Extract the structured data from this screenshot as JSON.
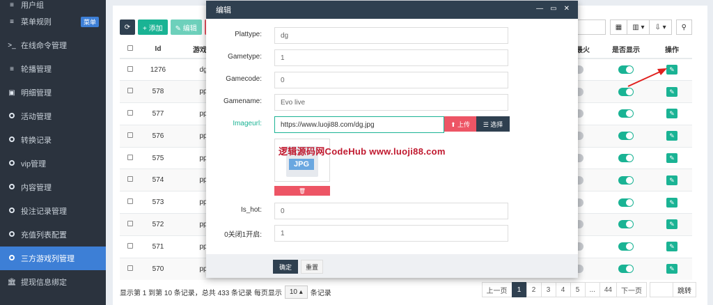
{
  "sidebar": {
    "top_item": "用户组",
    "items": [
      {
        "icon": "list-icon",
        "label": "菜单规则",
        "badge": "菜单"
      },
      {
        "icon": "terminal-icon",
        "label": "在线命令管理"
      },
      {
        "icon": "list-icon",
        "label": "轮播管理"
      },
      {
        "icon": "calendar-icon",
        "label": "明细管理"
      },
      {
        "icon": "circle-icon",
        "label": "活动管理"
      },
      {
        "icon": "circle-icon",
        "label": "转换记录"
      },
      {
        "icon": "circle-icon",
        "label": "vip管理"
      },
      {
        "icon": "circle-icon",
        "label": "内容管理"
      },
      {
        "icon": "circle-icon",
        "label": "投注记录管理"
      },
      {
        "icon": "circle-icon",
        "label": "充值列表配置"
      },
      {
        "icon": "circle-icon",
        "label": "三方游戏列管理"
      },
      {
        "icon": "bank-icon",
        "label": "提现信息绑定"
      }
    ]
  },
  "toolbar": {
    "refresh_glyph": "⟳",
    "add_label": "+ 添加",
    "edit_label": "✎ 编辑"
  },
  "right_tools": [
    "▦",
    "▥ ▾",
    "⇩ ▾",
    "⚲"
  ],
  "table": {
    "headers": [
      "",
      "Id",
      "游戏类",
      "是否最火",
      "是否显示",
      "操作"
    ],
    "rows": [
      {
        "id": "1276",
        "code": "dg"
      },
      {
        "id": "578",
        "code": "pp"
      },
      {
        "id": "577",
        "code": "pp"
      },
      {
        "id": "576",
        "code": "pp"
      },
      {
        "id": "575",
        "code": "pp"
      },
      {
        "id": "574",
        "code": "pp"
      },
      {
        "id": "573",
        "code": "pp"
      },
      {
        "id": "572",
        "code": "pp"
      },
      {
        "id": "571",
        "code": "pp"
      },
      {
        "id": "570",
        "code": "pp"
      }
    ]
  },
  "footer": {
    "summary": "显示第 1 到第 10 条记录，总共 433 条记录 每页显示",
    "page_size": "10 ▴",
    "page_size_suffix": "条记录"
  },
  "pager": {
    "prev": "上一页",
    "pages": [
      "1",
      "2",
      "3",
      "4",
      "5",
      "...",
      "44"
    ],
    "next": "下一页",
    "go": "跳转"
  },
  "modal": {
    "title": "编辑",
    "ctrl_min": "—",
    "ctrl_max": "▭",
    "ctrl_close": "✕",
    "fields": {
      "plattype": {
        "label": "Plattype:",
        "value": "dg"
      },
      "gametype": {
        "label": "Gametype:",
        "value": "1"
      },
      "gamecode": {
        "label": "Gamecode:",
        "value": "0"
      },
      "gamename": {
        "label": "Gamename:",
        "value": "Evo live"
      },
      "imageurl": {
        "label": "Imageurl:",
        "value": "https://www.luoji88.com/dg.jpg"
      },
      "is_hot": {
        "label": "Is_hot:",
        "value": "0"
      },
      "toggle": {
        "label": "0关闭1开启:",
        "value": "1"
      }
    },
    "upload_label": "⬆ 上传",
    "choose_label": "☰ 选择",
    "thumb_label": "JPG",
    "delete_glyph": "🗑",
    "watermark": "逻辑源码网CodeHub www.luoji88.com",
    "ok_label": "确定",
    "reset_label": "重置"
  },
  "colors": {
    "sidebar_bg": "#2b333e",
    "active_blue": "#3d7fd6",
    "accent_green": "#1ab394",
    "danger_red": "#ed5565",
    "navy": "#2f4050",
    "annotation_arrow": "#e0201e"
  }
}
